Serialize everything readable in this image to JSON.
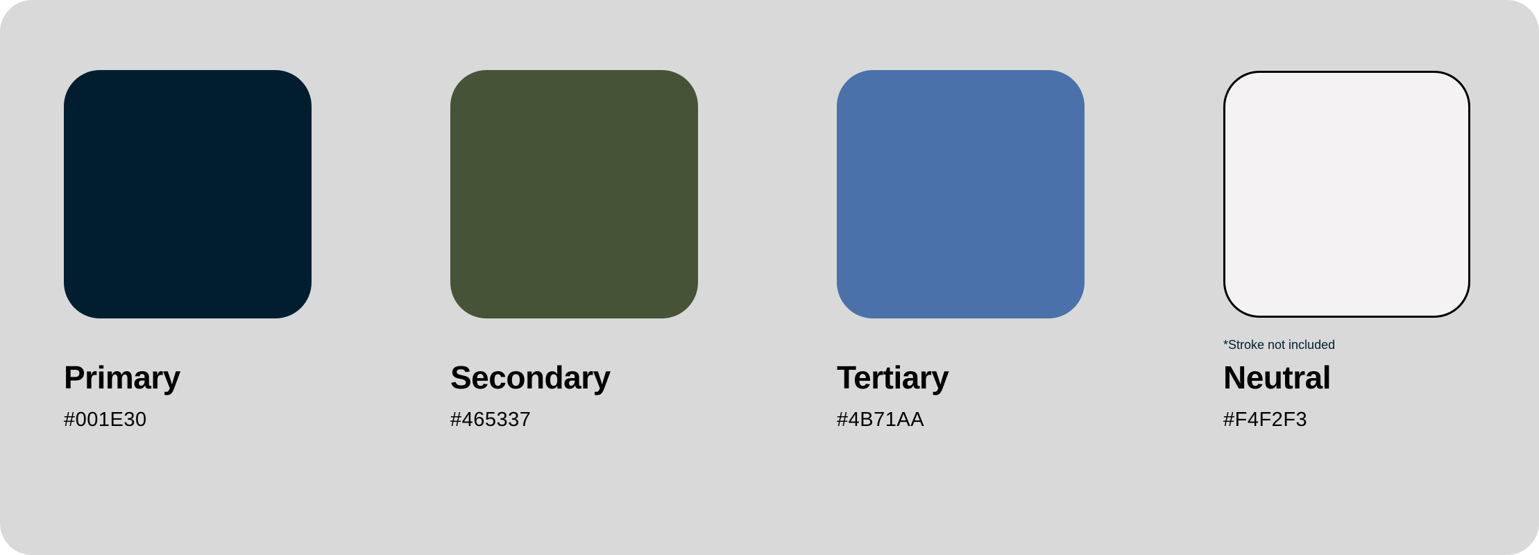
{
  "palette": {
    "swatches": [
      {
        "name": "Primary",
        "hex": "#001E30",
        "color": "#001E30"
      },
      {
        "name": "Secondary",
        "hex": "#465337",
        "color": "#465337"
      },
      {
        "name": "Tertiary",
        "hex": "#4B71AA",
        "color": "#4B71AA"
      },
      {
        "name": "Neutral",
        "hex": "#F4F2F3",
        "color": "#F4F2F3",
        "note": "*Stroke not included"
      }
    ]
  }
}
